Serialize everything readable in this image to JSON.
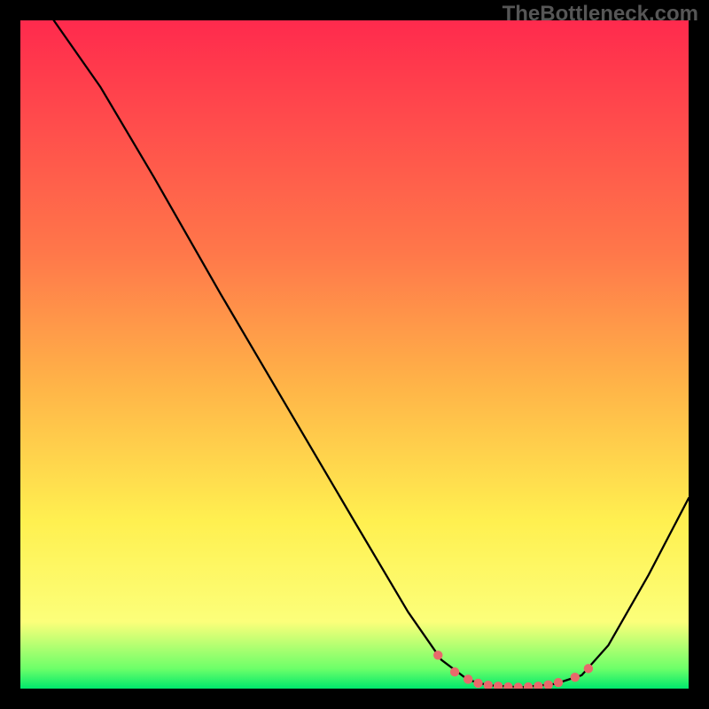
{
  "watermark": "TheBottleneck.com",
  "chart_data": {
    "type": "line",
    "title": "",
    "xlabel": "",
    "ylabel": "",
    "x_range": [
      0,
      100
    ],
    "y_range": [
      0,
      100
    ],
    "gradient": {
      "stops": [
        {
          "offset": 0,
          "color": "#ff2a4d"
        },
        {
          "offset": 35,
          "color": "#ff784a"
        },
        {
          "offset": 55,
          "color": "#ffb548"
        },
        {
          "offset": 75,
          "color": "#fff050"
        },
        {
          "offset": 90,
          "color": "#fcff7a"
        },
        {
          "offset": 97,
          "color": "#6dff69"
        },
        {
          "offset": 100,
          "color": "#00e86c"
        }
      ]
    },
    "curve": [
      {
        "x": 5.0,
        "y": 100.0
      },
      {
        "x": 12.0,
        "y": 90.0
      },
      {
        "x": 20.0,
        "y": 76.5
      },
      {
        "x": 30.0,
        "y": 59.0
      },
      {
        "x": 40.0,
        "y": 42.0
      },
      {
        "x": 50.0,
        "y": 25.0
      },
      {
        "x": 58.0,
        "y": 11.5
      },
      {
        "x": 63.0,
        "y": 4.3
      },
      {
        "x": 67.0,
        "y": 1.3
      },
      {
        "x": 70.0,
        "y": 0.5
      },
      {
        "x": 75.0,
        "y": 0.2
      },
      {
        "x": 80.0,
        "y": 0.7
      },
      {
        "x": 84.0,
        "y": 2.0
      },
      {
        "x": 88.0,
        "y": 6.5
      },
      {
        "x": 94.0,
        "y": 17.0
      },
      {
        "x": 100.0,
        "y": 28.5
      }
    ],
    "markers": [
      {
        "x": 62.5,
        "y": 5.0
      },
      {
        "x": 65.0,
        "y": 2.5
      },
      {
        "x": 67.0,
        "y": 1.4
      },
      {
        "x": 68.5,
        "y": 0.8
      },
      {
        "x": 70.0,
        "y": 0.5
      },
      {
        "x": 71.5,
        "y": 0.35
      },
      {
        "x": 73.0,
        "y": 0.25
      },
      {
        "x": 74.5,
        "y": 0.2
      },
      {
        "x": 76.0,
        "y": 0.25
      },
      {
        "x": 77.5,
        "y": 0.35
      },
      {
        "x": 79.0,
        "y": 0.55
      },
      {
        "x": 80.5,
        "y": 0.9
      },
      {
        "x": 83.0,
        "y": 1.7
      },
      {
        "x": 85.0,
        "y": 3.0
      }
    ],
    "marker_color": "#e8696b",
    "marker_radius": 5.2,
    "line_color": "#000000",
    "line_width": 2.3
  }
}
